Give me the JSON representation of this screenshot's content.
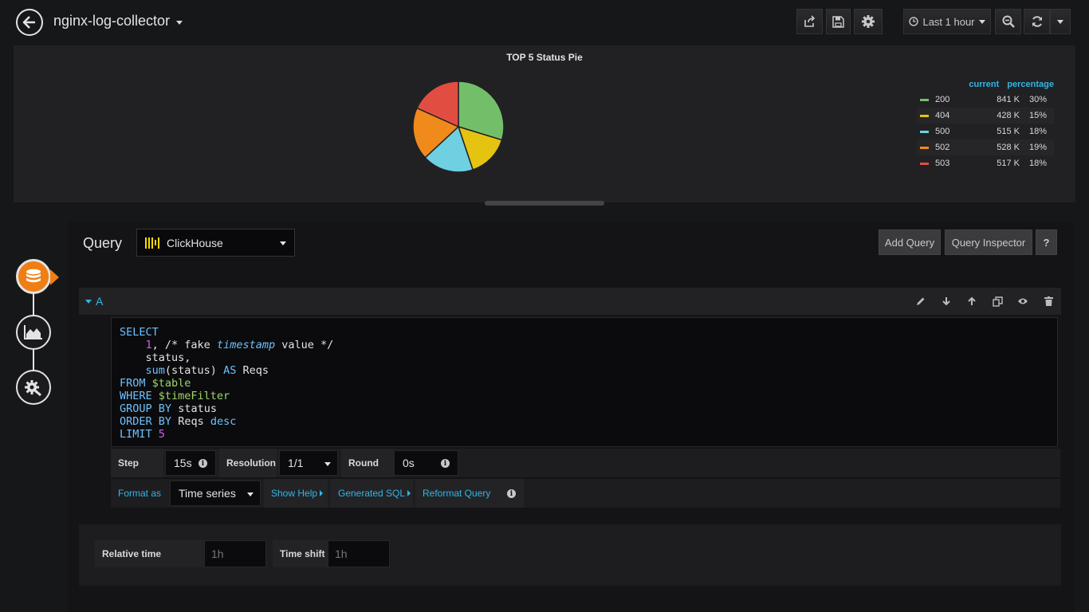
{
  "dashboard": {
    "title": "nginx-log-collector"
  },
  "toolbar": {
    "time_range": "Last 1 hour"
  },
  "panel": {
    "title": "TOP 5 Status Pie",
    "legend_headers": {
      "current": "current",
      "percentage": "percentage"
    }
  },
  "chart_data": {
    "type": "pie",
    "title": "TOP 5 Status Pie",
    "slices": [
      {
        "name": "200",
        "current": "841 K",
        "percentage": "30%",
        "value": 841,
        "color": "#73bf69"
      },
      {
        "name": "404",
        "current": "428 K",
        "percentage": "15%",
        "value": 428,
        "color": "#e5c311"
      },
      {
        "name": "500",
        "current": "515 K",
        "percentage": "18%",
        "value": 515,
        "color": "#6ed0e0"
      },
      {
        "name": "502",
        "current": "528 K",
        "percentage": "19%",
        "value": 528,
        "color": "#ef8a1b"
      },
      {
        "name": "503",
        "current": "517 K",
        "percentage": "18%",
        "value": 517,
        "color": "#e24d42"
      }
    ],
    "legend_placement": "right"
  },
  "query": {
    "label": "Query",
    "datasource": "ClickHouse",
    "add_query": "Add Query",
    "inspector": "Query Inspector",
    "help": "?",
    "ref_id": "A",
    "options": {
      "step_label": "Step",
      "step_value": "15s",
      "resolution_label": "Resolution",
      "resolution_value": "1/1",
      "round_label": "Round",
      "round_value": "0s",
      "format_label": "Format as",
      "format_value": "Time series",
      "show_help": "Show Help",
      "generated_sql": "Generated SQL",
      "reformat": "Reformat Query"
    }
  },
  "time_options": {
    "relative_label": "Relative time",
    "relative_placeholder": "1h",
    "shift_label": "Time shift",
    "shift_placeholder": "1h"
  },
  "sql": {
    "select": "SELECT",
    "one": "1",
    "comment_a": ", /* fake ",
    "timestamp": "timestamp",
    "comment_b": " value */",
    "status_line": "status,",
    "sum": "sum",
    "sum_arg": "(status)",
    "as_kw": "AS",
    "reqs": "Reqs",
    "from": "FROM",
    "table": "$table",
    "where": "WHERE",
    "timefilter": "$timeFilter",
    "group": "GROUP",
    "by": "BY",
    "status": "status",
    "order": "ORDER",
    "desc": "desc",
    "limit": "LIMIT",
    "five": "5"
  }
}
